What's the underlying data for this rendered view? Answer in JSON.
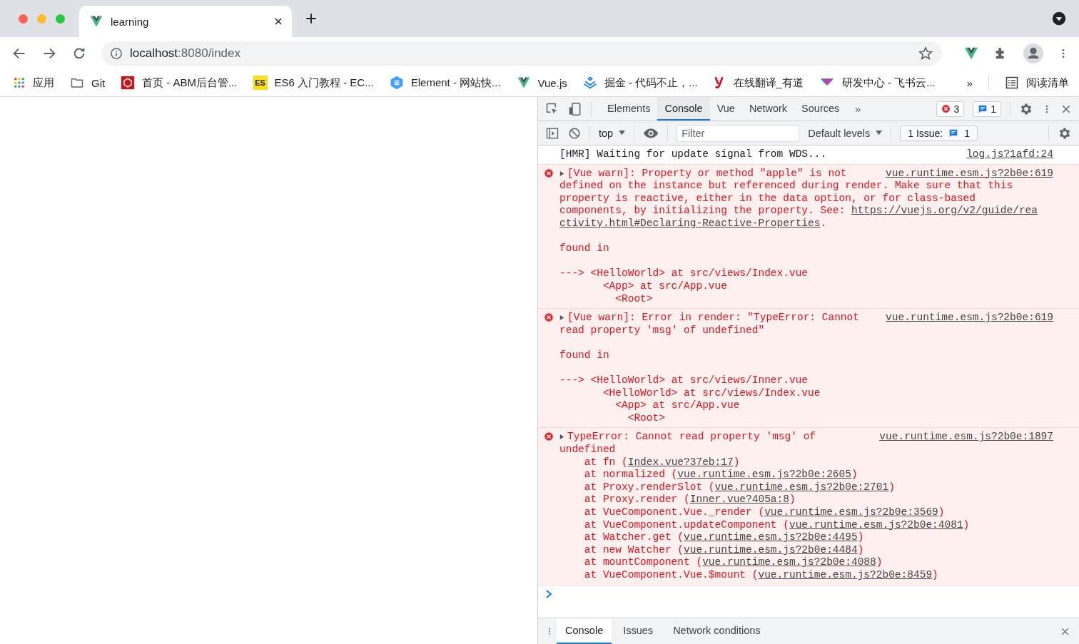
{
  "browser": {
    "tab": {
      "title": "learning"
    },
    "address": {
      "host": "localhost",
      "rest": ":8080/index"
    },
    "bookmarks": [
      {
        "kind": "apps",
        "label": "应用"
      },
      {
        "kind": "folder",
        "label": "Git"
      },
      {
        "kind": "abm",
        "label": "首页 - ABM后台管..."
      },
      {
        "kind": "es",
        "badge": "ES",
        "label": "ES6 入门教程 - EC..."
      },
      {
        "kind": "element",
        "label": "Element - 网站快..."
      },
      {
        "kind": "vue",
        "label": "Vue.js"
      },
      {
        "kind": "juejin",
        "label": "掘金 - 代码不止，..."
      },
      {
        "kind": "youdao",
        "label": "在线翻译_有道"
      },
      {
        "kind": "feishu",
        "label": "研发中心 - 飞书云..."
      }
    ],
    "bookmarks_overflow": "»",
    "reading_list": "阅读清单"
  },
  "devtools": {
    "tabs": [
      {
        "label": "Elements",
        "selected": false
      },
      {
        "label": "Console",
        "selected": true
      },
      {
        "label": "Vue",
        "selected": false
      },
      {
        "label": "Network",
        "selected": false
      },
      {
        "label": "Sources",
        "selected": false
      }
    ],
    "more_tabs": "»",
    "error_count": "3",
    "message_count": "1",
    "context": "top",
    "filter": {
      "placeholder": "Filter"
    },
    "levels": "Default levels",
    "issues": {
      "label": "1 Issue:",
      "count": "1"
    },
    "messages": [
      {
        "kind": "log",
        "source": "log.js?1afd:24",
        "lines": [
          "[HMR] Waiting for update signal from WDS..."
        ]
      },
      {
        "kind": "error",
        "expanded": false,
        "source": "vue.runtime.esm.js?2b0e:619",
        "lines": [
          "[Vue warn]: Property or method \"apple\" is not",
          "defined on the instance but referenced during render. Make sure that this",
          "property is reactive, either in the data option, or for class-based",
          [
            {
              "text": "components, by initializing the property. See: "
            },
            {
              "text": "https://vuejs.org/v2/guide/rea",
              "link": true
            }
          ],
          [
            {
              "text": "ctivity.html#Declaring-Reactive-Properties",
              "link": true
            },
            {
              "text": "."
            }
          ]
        ],
        "sections": [
          {
            "kind": "text",
            "lines": [
              "found in"
            ]
          },
          {
            "kind": "tree",
            "node": {
              "text": "---> <HelloWorld> at src/views/Index.vue",
              "children": [
                {
                  "text": "<App> at src/App.vue",
                  "children": [
                    {
                      "text": "<Root>"
                    }
                  ]
                }
              ]
            }
          }
        ]
      },
      {
        "kind": "error",
        "expanded": false,
        "source": "vue.runtime.esm.js?2b0e:619",
        "lines": [
          "[Vue warn]: Error in render: \"TypeError: Cannot",
          "read property 'msg' of undefined\""
        ],
        "sections": [
          {
            "kind": "text",
            "lines": [
              "found in"
            ]
          },
          {
            "kind": "tree",
            "node": {
              "text": "---> <HelloWorld> at src/views/Inner.vue",
              "children": [
                {
                  "text": "<HelloWorld> at src/views/Index.vue",
                  "children": [
                    {
                      "text": "<App> at src/App.vue",
                      "children": [
                        {
                          "text": "<Root>"
                        }
                      ]
                    }
                  ]
                }
              ]
            }
          }
        ]
      },
      {
        "kind": "error",
        "expanded": false,
        "source": "vue.runtime.esm.js?2b0e:1897",
        "lines": [
          "TypeError: Cannot read property 'msg' of",
          "undefined"
        ],
        "stack": [
          [
            {
              "text": "at fn ("
            },
            {
              "text": "Index.vue?37eb:17",
              "link": true
            },
            {
              "text": ")"
            }
          ],
          [
            {
              "text": "at normalized ("
            },
            {
              "text": "vue.runtime.esm.js?2b0e:2605",
              "link": true
            },
            {
              "text": ")"
            }
          ],
          [
            {
              "text": "at Proxy.renderSlot ("
            },
            {
              "text": "vue.runtime.esm.js?2b0e:2701",
              "link": true
            },
            {
              "text": ")"
            }
          ],
          [
            {
              "text": "at Proxy.render ("
            },
            {
              "text": "Inner.vue?405a:8",
              "link": true
            },
            {
              "text": ")"
            }
          ],
          [
            {
              "text": "at VueComponent.Vue._render ("
            },
            {
              "text": "vue.runtime.esm.js?2b0e:3569",
              "link": true
            },
            {
              "text": ")"
            }
          ],
          [
            {
              "text": "at VueComponent.updateComponent ("
            },
            {
              "text": "vue.runtime.esm.js?2b0e:4081",
              "link": true
            },
            {
              "text": ")"
            }
          ],
          [
            {
              "text": "at Watcher.get ("
            },
            {
              "text": "vue.runtime.esm.js?2b0e:4495",
              "link": true
            },
            {
              "text": ")"
            }
          ],
          [
            {
              "text": "at new Watcher ("
            },
            {
              "text": "vue.runtime.esm.js?2b0e:4484",
              "link": true
            },
            {
              "text": ")"
            }
          ],
          [
            {
              "text": "at mountComponent ("
            },
            {
              "text": "vue.runtime.esm.js?2b0e:4088",
              "link": true
            },
            {
              "text": ")"
            }
          ],
          [
            {
              "text": "at VueComponent.Vue.$mount ("
            },
            {
              "text": "vue.runtime.esm.js?2b0e:8459",
              "link": true
            },
            {
              "text": ")"
            }
          ]
        ]
      }
    ],
    "drawer_tabs": [
      {
        "label": "Console",
        "selected": true
      },
      {
        "label": "Issues",
        "selected": false
      },
      {
        "label": "Network conditions",
        "selected": false
      }
    ]
  }
}
